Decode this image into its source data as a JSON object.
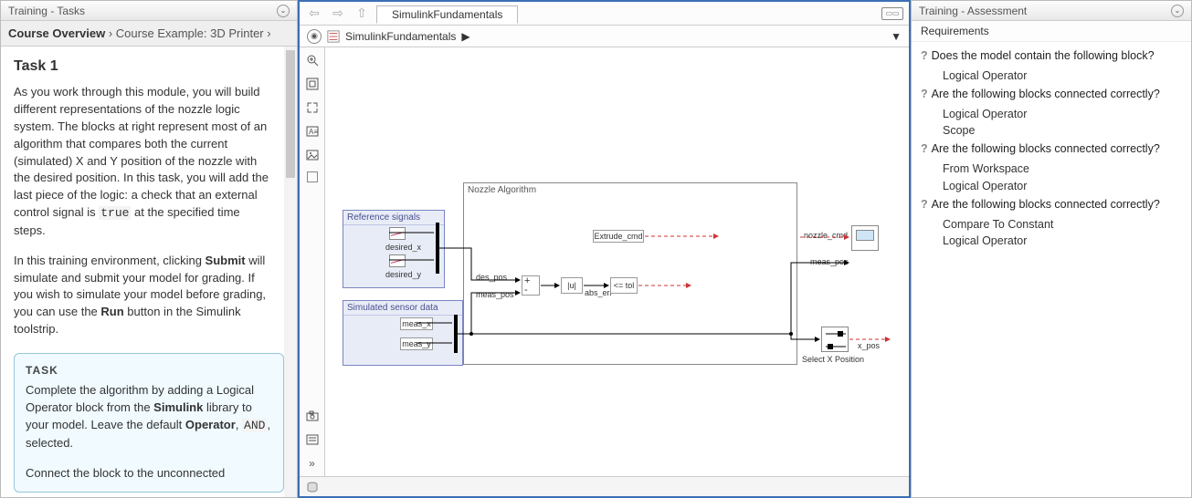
{
  "left": {
    "title": "Training - Tasks",
    "breadcrumb_bold": "Course Overview",
    "breadcrumb_rest": "Course Example: 3D Printer",
    "task_heading": "Task 1",
    "para1a": "As you work through this module, you will build different representations of the nozzle logic system. The blocks at right represent most of an algorithm that compares both the current (simulated) X and Y position of the nozzle with the desired position. In this task, you will add the last piece of the logic: a check that an external control signal is ",
    "code1": "true",
    "para1b": " at the specified time steps.",
    "para2a": "In this training environment, clicking ",
    "bold_submit": "Submit",
    "para2b": " will simulate and submit your model for grading. If you wish to simulate your model before grading, you can use the ",
    "bold_run": "Run",
    "para2c": " button in the Simulink toolstrip.",
    "taskbox_label": "TASK",
    "taskbox_p1a": "Complete the algorithm by adding a Logical Operator block from the ",
    "taskbox_bold1": "Simulink",
    "taskbox_p1b": " library to your model. Leave the default ",
    "taskbox_bold2": "Operator",
    "taskbox_p1c": ", ",
    "taskbox_code": "AND",
    "taskbox_p1d": ", selected.",
    "taskbox_p2": "Connect the block to the unconnected"
  },
  "center": {
    "tab": "SimulinkFundamentals",
    "path": "SimulinkFundamentals",
    "algo_title": "Nozzle Algorithm",
    "ref_title": "Reference signals",
    "sim_title": "Simulated sensor data",
    "desired_x": "desired_x",
    "desired_y": "desired_y",
    "meas_x": "meas_x",
    "meas_y": "meas_y",
    "des_pos": "des_pos",
    "meas_pos": "meas_pos",
    "abs_err": "abs_err",
    "le_tol": "<= tol",
    "abs_u": "|u|",
    "extrude_cmd": "Extrude_cmd",
    "nozzle_cmd": "nozzle_cmd",
    "meas_pos_out": "meas_pos",
    "select_x": "Select X Position",
    "x_pos": "x_pos"
  },
  "right": {
    "title": "Training - Assessment",
    "section": "Requirements",
    "items": [
      {
        "q": "Does the model contain the following block?",
        "subs": [
          "Logical Operator"
        ]
      },
      {
        "q": "Are the following blocks connected correctly?",
        "subs": [
          "Logical Operator",
          "Scope"
        ]
      },
      {
        "q": "Are the following blocks connected correctly?",
        "subs": [
          "From Workspace",
          "Logical Operator"
        ]
      },
      {
        "q": "Are the following blocks connected correctly?",
        "subs": [
          "Compare To Constant",
          "Logical Operator"
        ]
      }
    ]
  }
}
